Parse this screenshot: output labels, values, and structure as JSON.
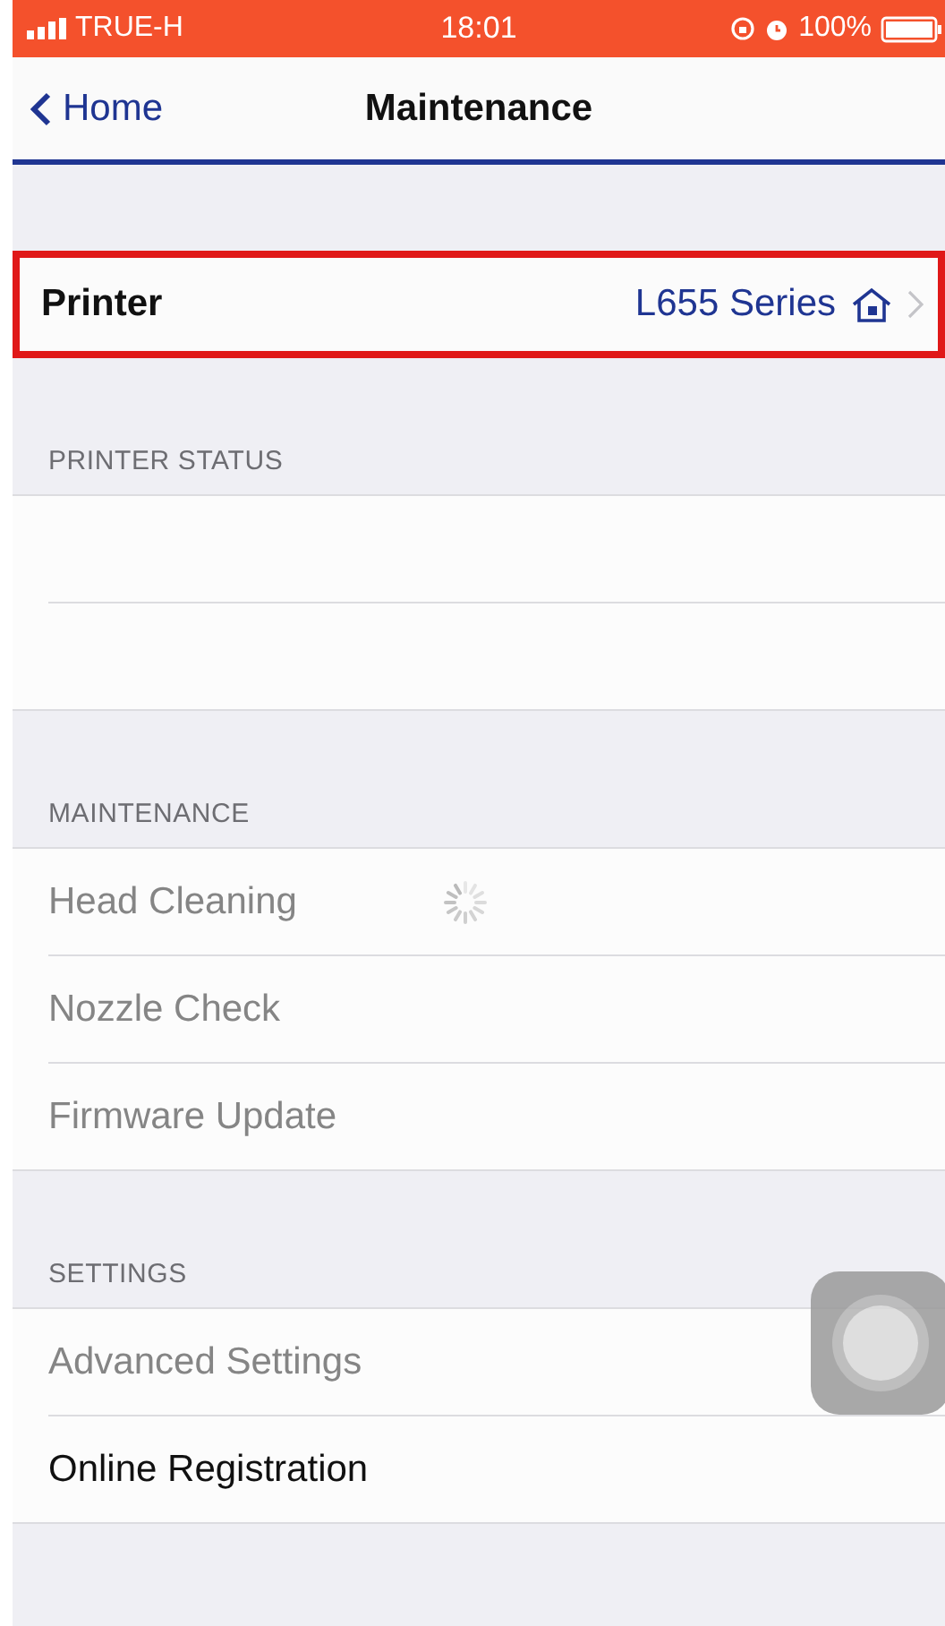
{
  "status_bar": {
    "carrier": "TRUE-H",
    "time": "18:01",
    "battery": "100%"
  },
  "nav": {
    "back": "Home",
    "title": "Maintenance"
  },
  "printer": {
    "label": "Printer",
    "value": "L655 Series",
    "highlighted": true
  },
  "sections": [
    {
      "header": "PRINTER STATUS",
      "rows": [
        {
          "kind": "blank"
        },
        {
          "kind": "blank"
        }
      ]
    },
    {
      "header": "MAINTENANCE",
      "rows": [
        {
          "kind": "item",
          "label": "Head Cleaning",
          "disabled": true,
          "loading": true
        },
        {
          "kind": "item",
          "label": "Nozzle Check",
          "disabled": true,
          "loading": false
        },
        {
          "kind": "item",
          "label": "Firmware Update",
          "disabled": true,
          "loading": false
        }
      ]
    },
    {
      "header": "SETTINGS",
      "rows": [
        {
          "kind": "item",
          "label": "Advanced Settings",
          "disabled": true,
          "loading": false
        },
        {
          "kind": "item",
          "label": "Online Registration",
          "disabled": false,
          "loading": false
        }
      ]
    }
  ]
}
